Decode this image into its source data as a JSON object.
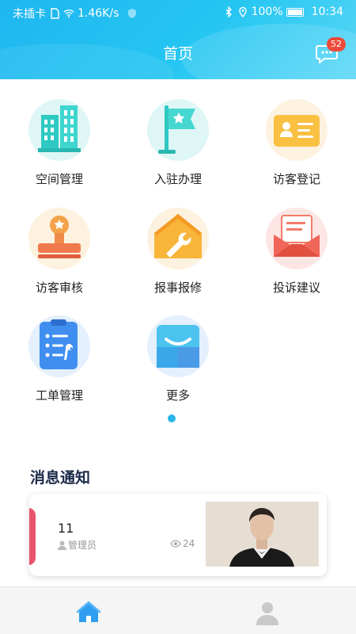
{
  "status_bar": {
    "carrier": "未插卡",
    "speed": "1.46K/s",
    "battery": "100%",
    "time": "10:34"
  },
  "header": {
    "title": "首页",
    "message_badge": "52"
  },
  "grid": [
    {
      "label": "空间管理",
      "icon": "building-icon",
      "bg": "#dff6f6"
    },
    {
      "label": "入驻办理",
      "icon": "flag-icon",
      "bg": "#dff6f6"
    },
    {
      "label": "访客登记",
      "icon": "visitor-card-icon",
      "bg": "#fdf2df"
    },
    {
      "label": "访客审核",
      "icon": "stamp-icon",
      "bg": "#fdf2df"
    },
    {
      "label": "报事报修",
      "icon": "repair-house-icon",
      "bg": "#fdf2df"
    },
    {
      "label": "投诉建议",
      "icon": "envelope-icon",
      "bg": "#fde6e4"
    },
    {
      "label": "工单管理",
      "icon": "clipboard-icon",
      "bg": "#e4f0fd"
    },
    {
      "label": "更多",
      "icon": "more-icon",
      "bg": "#e4f0fd"
    }
  ],
  "notifications": {
    "title": "消息通知",
    "items": [
      {
        "title": "11",
        "author": "管理员",
        "views": "24"
      }
    ]
  },
  "colors": {
    "header_start": "#1fb6f0",
    "accent_dot": "#27b7e8",
    "badge": "#ee4a3a"
  }
}
